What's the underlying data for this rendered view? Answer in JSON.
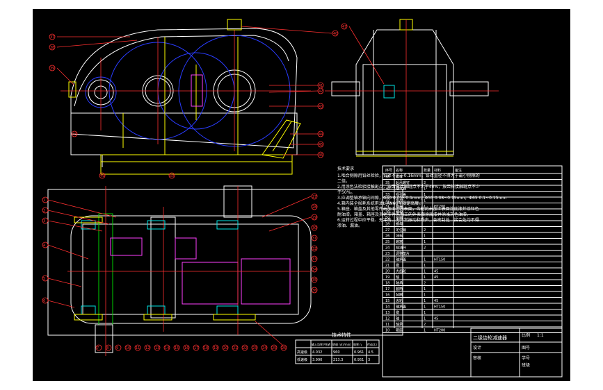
{
  "notes": {
    "heading": "技术要求",
    "lines": [
      "1.啮合侧隙用铅丝检验，铅丝不小于0.16mm，铅丝直径不得大于最小侧隙的",
      "二倍。",
      "2.用涂色法检验接触斑点，按齿高接触斑点不少于40%，按齿长接触斑点不少",
      "于50%。",
      "3.应调整轴承轴向间隙，Φ40 0.05~0.1mm，Φ55 0.08~0.15mm，Φ65 0.1~0.15mm",
      "4.箱内装全损耗系统用油L-AN68至规定高度。",
      "5.箱座、箱盖及其他零件未加工的内表面，齿轮的未加工表面涂底漆并涂红色",
      "耐油漆。箱盖、箱座及其他零件未加工的外表面涂底漆并涂浅灰色油漆。",
      "6.运转过程中应平稳、无冲击、无异常振动和噪声，各密封处、接合处均不得",
      "渗油、漏油。"
    ]
  },
  "spec_table": {
    "title": "技术特性",
    "headers": [
      "输入功率 P/kW",
      "转速 n/(r/min)",
      "效率 η",
      "传动比 i"
    ],
    "rows": [
      [
        "高速级",
        "4.032",
        "960",
        "0.961",
        "4.5"
      ],
      [
        "低速级",
        "3.990",
        "213.3",
        "0.951",
        "3"
      ]
    ]
  },
  "parts_list": {
    "header": [
      "序号",
      "名称",
      "数量",
      "材料",
      "备注"
    ],
    "rows": [
      [
        "36",
        "螺栓",
        "",
        "",
        ""
      ],
      [
        "35",
        "起吊螺钉",
        "2",
        "",
        ""
      ],
      [
        "34",
        "通气器",
        "1",
        "",
        ""
      ],
      [
        "33",
        "视孔盖",
        "1",
        "",
        ""
      ],
      [
        "32",
        "垫片",
        "1",
        "",
        ""
      ],
      [
        "31",
        "箱盖",
        "1",
        "HT200",
        ""
      ],
      [
        "30",
        "螺栓",
        "",
        "",
        ""
      ],
      [
        "29",
        "垫圈",
        "",
        "",
        ""
      ],
      [
        "28",
        "螺母",
        "",
        "",
        ""
      ],
      [
        "27",
        "定位销",
        "2",
        "",
        ""
      ],
      [
        "26",
        "油标",
        "1",
        "",
        ""
      ],
      [
        "25",
        "螺塞",
        "1",
        "",
        ""
      ],
      [
        "24",
        "挡油环",
        "2",
        "",
        ""
      ],
      [
        "23",
        "调整垫片",
        "",
        "",
        ""
      ],
      [
        "22",
        "轴承盖",
        "1",
        "HT150",
        ""
      ],
      [
        "21",
        "键",
        "1",
        "",
        ""
      ],
      [
        "20",
        "大齿轮",
        "1",
        "45",
        ""
      ],
      [
        "19",
        "轴",
        "1",
        "45",
        ""
      ],
      [
        "18",
        "轴承",
        "2",
        "",
        ""
      ],
      [
        "17",
        "套筒",
        "1",
        "",
        ""
      ],
      [
        "16",
        "毡圈",
        "1",
        "",
        ""
      ],
      [
        "15",
        "齿轮",
        "1",
        "45",
        ""
      ],
      [
        "14",
        "轴承盖",
        "1",
        "HT150",
        ""
      ],
      [
        "13",
        "键",
        "1",
        "",
        ""
      ],
      [
        "12",
        "轴",
        "1",
        "45",
        ""
      ],
      [
        "11",
        "轴承",
        "2",
        "",
        ""
      ],
      [
        "10",
        "箱座",
        "1",
        "HT200",
        ""
      ]
    ]
  },
  "title_block": {
    "name": "二级齿轮减速器",
    "scale_label": "比例",
    "scale": "1:1",
    "sheet_label": "图号",
    "designer_label": "设计",
    "checker_label": "审核",
    "school": "学号",
    "class": "班级"
  },
  "balloons_front": [
    "37",
    "38",
    "39",
    "40",
    "41",
    "42",
    "43",
    "44",
    "45",
    "46",
    "47",
    "48",
    "49",
    "50"
  ],
  "balloons_top": [
    "1",
    "2",
    "3",
    "4",
    "5",
    "6",
    "7",
    "8",
    "9",
    "10",
    "11",
    "12",
    "13",
    "14",
    "15",
    "16",
    "17",
    "18",
    "19",
    "20",
    "21",
    "22",
    "23",
    "24",
    "25",
    "26",
    "27",
    "28",
    "29",
    "30",
    "31",
    "32",
    "33",
    "34",
    "35",
    "36"
  ]
}
